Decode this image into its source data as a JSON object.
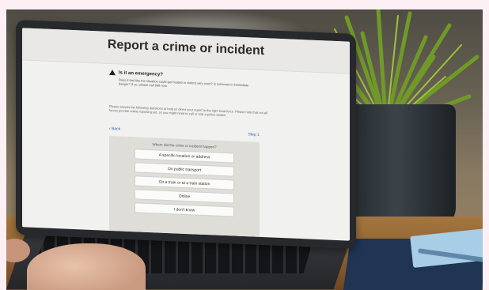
{
  "screen": {
    "title": "Report a crime or incident",
    "emergency": {
      "heading": "Is it an emergency?",
      "body": "Does it feel like the situation could get heated or violent very soon? Is someone in immediate danger? If so, please call 999 now."
    },
    "intro": "Please answer the following questions to help us direct your report to the right local force. Please note that not all forces provide online reporting yet, so you might need to call or visit a police station.",
    "back_label": "Back",
    "step_label": "Step 1",
    "question": "Where did the crime or incident happen?",
    "options": [
      "A specific location or address",
      "On public transport",
      "On a train or at a train station",
      "Online",
      "I don't know"
    ]
  },
  "colors": {
    "page_bg": "#fdf0f4",
    "link": "#2a66b8"
  }
}
